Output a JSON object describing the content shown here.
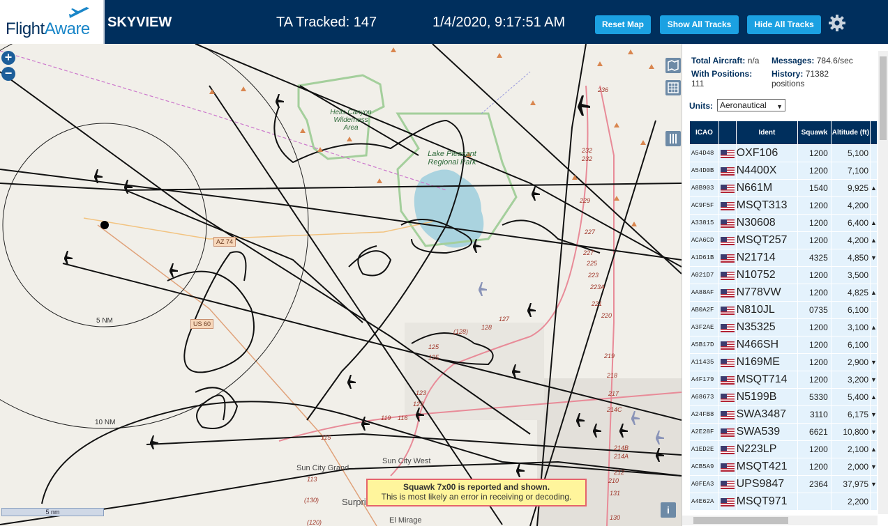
{
  "header": {
    "logo_main": "Flight",
    "logo_accent": "Aware",
    "title": "SKYVIEW",
    "tracked_label": "TA Tracked: 147",
    "datetime": "1/4/2020, 9:17:51 AM",
    "buttons": {
      "reset_map": "Reset Map",
      "show_all_tracks": "Show All Tracks",
      "hide_all_tracks": "Hide All Tracks"
    }
  },
  "map": {
    "zoom_in": "+",
    "zoom_out": "−",
    "labels": {
      "range_5nm": "5 NM",
      "range_10nm": "10 NM",
      "park_hells_canyon": "Hells Canyon Wilderness Area",
      "park_lake_pleasant": "Lake Pleasant Regional Park",
      "sun_city_grand": "Sun City Grand",
      "sun_city_west": "Sun City West",
      "surprise": "Surprise",
      "el_mirage": "El Mirage"
    },
    "shields": {
      "az74": "AZ 74",
      "us60": "US 60"
    },
    "route_numbers": [
      "236",
      "232",
      "232",
      "229",
      "227",
      "227",
      "225",
      "223",
      "223A",
      "221",
      "220",
      "219",
      "218",
      "217",
      "214C",
      "214B",
      "214A",
      "212",
      "210",
      "131",
      "130",
      "128",
      "127",
      "125",
      "125",
      "123",
      "123",
      "119",
      "116",
      "115",
      "113",
      "(130)",
      "(120)",
      "(128)"
    ],
    "scale": "5 nm",
    "info": "i",
    "alert": {
      "title": "Squawk 7x00 is reported and shown.",
      "detail": "This is most likely an error in receiving or decoding."
    }
  },
  "sidebar": {
    "total_aircraft_label": "Total Aircraft:",
    "total_aircraft_value": "n/a",
    "messages_label": "Messages:",
    "messages_value": "784.6/sec",
    "with_positions_label": "With Positions:",
    "with_positions_value": "111",
    "history_label": "History:",
    "history_value": "71382",
    "history_unit": "positions",
    "units_label": "Units:",
    "units_value": "Aeronautical",
    "columns": [
      "ICAO",
      "",
      "Ident",
      "Squawk",
      "Altitude (ft)"
    ],
    "rows": [
      {
        "icao": "A54D48",
        "ident": "OXF106",
        "squawk": "1200",
        "alt": "5,100",
        "dir": ""
      },
      {
        "icao": "A54D0B",
        "ident": "N4400X",
        "squawk": "1200",
        "alt": "7,100",
        "dir": ""
      },
      {
        "icao": "A8B903",
        "ident": "N661M",
        "squawk": "1540",
        "alt": "9,925",
        "dir": "▲"
      },
      {
        "icao": "AC9F5F",
        "ident": "MSQT313",
        "squawk": "1200",
        "alt": "4,200",
        "dir": ""
      },
      {
        "icao": "A33815",
        "ident": "N30608",
        "squawk": "1200",
        "alt": "6,400",
        "dir": "▲"
      },
      {
        "icao": "ACA6CD",
        "ident": "MSQT257",
        "squawk": "1200",
        "alt": "4,200",
        "dir": "▲"
      },
      {
        "icao": "A1D61B",
        "ident": "N21714",
        "squawk": "4325",
        "alt": "4,850",
        "dir": "▼"
      },
      {
        "icao": "A021D7",
        "ident": "N10752",
        "squawk": "1200",
        "alt": "3,500",
        "dir": ""
      },
      {
        "icao": "AA88AF",
        "ident": "N778VW",
        "squawk": "1200",
        "alt": "4,825",
        "dir": "▲"
      },
      {
        "icao": "AB0A2F",
        "ident": "N810JL",
        "squawk": "0735",
        "alt": "6,100",
        "dir": ""
      },
      {
        "icao": "A3F2AE",
        "ident": "N35325",
        "squawk": "1200",
        "alt": "3,100",
        "dir": "▲"
      },
      {
        "icao": "A5B17D",
        "ident": "N466SH",
        "squawk": "1200",
        "alt": "6,100",
        "dir": ""
      },
      {
        "icao": "A11435",
        "ident": "N169ME",
        "squawk": "1200",
        "alt": "2,900",
        "dir": "▼"
      },
      {
        "icao": "A4F179",
        "ident": "MSQT714",
        "squawk": "1200",
        "alt": "3,200",
        "dir": "▼"
      },
      {
        "icao": "A68673",
        "ident": "N5199B",
        "squawk": "5330",
        "alt": "5,400",
        "dir": "▲"
      },
      {
        "icao": "A24FB8",
        "ident": "SWA3487",
        "squawk": "3110",
        "alt": "6,175",
        "dir": "▼"
      },
      {
        "icao": "A2E28F",
        "ident": "SWA539",
        "squawk": "6621",
        "alt": "10,800",
        "dir": "▼"
      },
      {
        "icao": "A1ED2E",
        "ident": "N223LP",
        "squawk": "1200",
        "alt": "2,100",
        "dir": "▲"
      },
      {
        "icao": "ACB5A9",
        "ident": "MSQT421",
        "squawk": "1200",
        "alt": "2,000",
        "dir": "▼"
      },
      {
        "icao": "A0FEA3",
        "ident": "UPS9847",
        "squawk": "2364",
        "alt": "37,975",
        "dir": "▼"
      },
      {
        "icao": "A4E62A",
        "ident": "MSQT971",
        "squawk": "",
        "alt": "2,200",
        "dir": ""
      }
    ]
  }
}
